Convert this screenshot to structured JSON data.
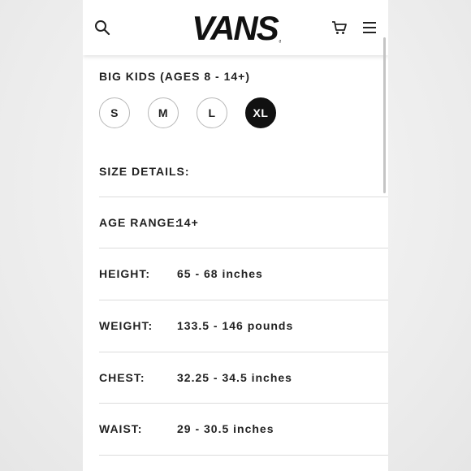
{
  "header": {
    "logo_text": "VANS",
    "icons": {
      "search": "search-icon",
      "cart": "cart-icon",
      "menu": "hamburger-menu-icon"
    }
  },
  "size_selector": {
    "title": "BIG KIDS (AGES 8 - 14+)",
    "options": [
      "S",
      "M",
      "L",
      "XL"
    ],
    "selected": "XL"
  },
  "size_details": {
    "title": "SIZE DETAILS:",
    "rows": [
      {
        "label": "AGE RANGE:",
        "value": "14+"
      },
      {
        "label": "HEIGHT:",
        "value": "65 - 68 inches"
      },
      {
        "label": "WEIGHT:",
        "value": "133.5 - 146 pounds"
      },
      {
        "label": "CHEST:",
        "value": "32.25 - 34.5 inches"
      },
      {
        "label": "WAIST:",
        "value": "29 - 30.5 inches"
      }
    ]
  },
  "colors": {
    "selected_bg": "#111111",
    "text": "#222222",
    "divider": "#dcdcdc"
  }
}
